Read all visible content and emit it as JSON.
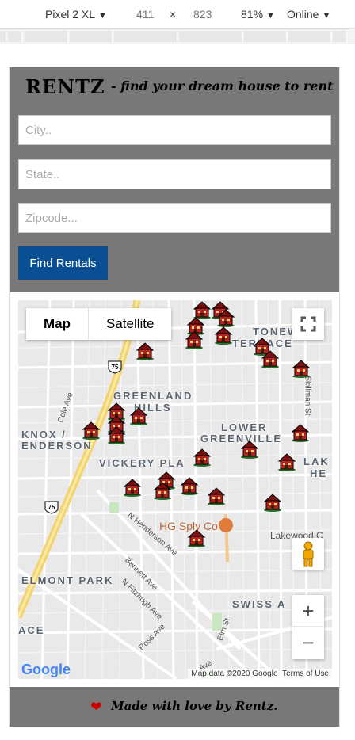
{
  "devtools": {
    "device": "Pixel 2 XL",
    "width": "411",
    "times": "×",
    "height": "823",
    "zoom": "81%",
    "throttle": "Online"
  },
  "header": {
    "brand": "RENTZ",
    "tagline": "- find your dream house to rent"
  },
  "search": {
    "city_placeholder": "City..",
    "state_placeholder": "State..",
    "zip_placeholder": "Zipcode...",
    "button_label": "Find Rentals"
  },
  "map": {
    "type_map": "Map",
    "type_satellite": "Satellite",
    "zoom_in": "+",
    "zoom_out": "−",
    "areas": {
      "greenland": "GREENLAND",
      "hills": "HILLS",
      "knox": "KNOX /",
      "henderson": "ENDERSON",
      "lower": "LOWER",
      "greenville": "GREENVILLE",
      "vickery": "VICKERY PLA",
      "stonewall": "TONEWA",
      "terrace": "TERRACE",
      "lak": "LAK",
      "he": "HE",
      "elmont": "ELMONT PARK",
      "swiss": "SWISS A",
      "ace": "ACE"
    },
    "streets": {
      "cole": "Cole Ave",
      "skillman": "Skillman St",
      "nhenderson": "N Henderson Ave",
      "bennett": "Bennett Ave",
      "fitzhugh": "N Fitzhugh Ave",
      "ross": "Ross Ave",
      "lakewood": "Lakewood C",
      "elm": "Elm St",
      "ave": "Ave"
    },
    "poi": "HG Sply Co",
    "highway": "75",
    "logo": "Google",
    "attribution_data": "Map data ©2020 Google",
    "attribution_terms": "Terms of Use"
  },
  "footer": {
    "text": "Made with love by Rentz."
  }
}
